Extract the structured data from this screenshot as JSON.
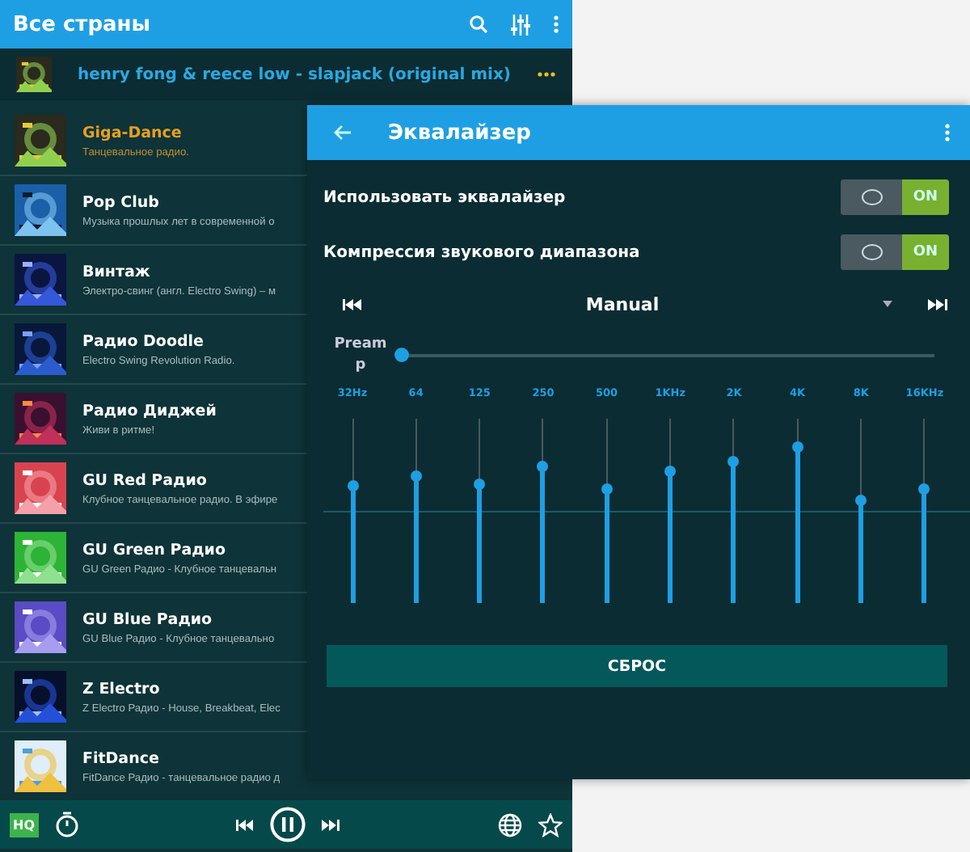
{
  "header": {
    "title": "Все страны"
  },
  "now_playing": {
    "track": "henry fong & reece low - slapjack (original mix)"
  },
  "stations": [
    {
      "name": "Giga-Dance",
      "description": "Танцевальное радио.",
      "selected": true
    },
    {
      "name": "Pop Club",
      "description": "Музыка прошлых лет в современной о",
      "selected": false
    },
    {
      "name": "Винтаж",
      "description": "Электро-свинг (англ. Electro Swing) – м",
      "selected": false
    },
    {
      "name": "Радио Doodle",
      "description": "Electro Swing Revolution Radio.",
      "selected": false
    },
    {
      "name": "Радио Диджей",
      "description": "Живи в ритме!",
      "selected": false
    },
    {
      "name": "GU Red Радио",
      "description": "Клубное танцевальное радио. В эфире",
      "selected": false
    },
    {
      "name": "GU Green Радио",
      "description": "GU Green Радио  - Клубное танцевальн",
      "selected": false
    },
    {
      "name": "GU Blue Радио",
      "description": "GU Blue  Радио  - Клубное танцевально",
      "selected": false
    },
    {
      "name": "Z Electro",
      "description": "Z Electro Радио - House, Breakbeat, Elec",
      "selected": false
    },
    {
      "name": "FitDance",
      "description": "FitDance Радио - танцевальное радио д",
      "selected": false
    }
  ],
  "player_bar": {
    "quality_badge": "HQ"
  },
  "equalizer": {
    "title": "Эквалайзер",
    "toggles": [
      {
        "label": "Использовать эквалайзер",
        "on": true,
        "state_label": "ON"
      },
      {
        "label": "Компрессия звукового диапазона",
        "on": true,
        "state_label": "ON"
      }
    ],
    "preset": "Manual",
    "preamp": {
      "label": "Preamp",
      "level": 0
    },
    "bands": [
      {
        "label": "32Hz",
        "level": 0.64
      },
      {
        "label": "64",
        "level": 0.69
      },
      {
        "label": "125",
        "level": 0.65
      },
      {
        "label": "250",
        "level": 0.75
      },
      {
        "label": "500",
        "level": 0.62
      },
      {
        "label": "1KHz",
        "level": 0.72
      },
      {
        "label": "2K",
        "level": 0.77
      },
      {
        "label": "4K",
        "level": 0.85
      },
      {
        "label": "8K",
        "level": 0.56
      },
      {
        "label": "16KHz",
        "level": 0.62
      }
    ],
    "reset_button": "СБРОС"
  }
}
